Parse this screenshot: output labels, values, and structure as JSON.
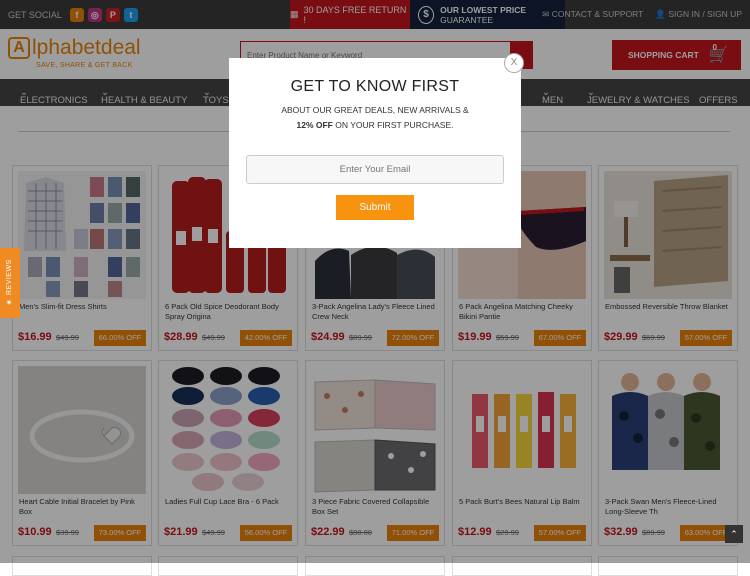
{
  "topbar": {
    "social_label": "GET SOCIAL",
    "social_icons": [
      "facebook-icon",
      "instagram-icon",
      "pinterest-icon",
      "twitter-icon"
    ],
    "promo_return": "30 DAYS FREE RETURN !",
    "promo_price_bold": "OUR LOWEST PRICE",
    "promo_price_rest": "GUARANTEE",
    "contact": "CONTACT & SUPPORT",
    "signin": "SIGN IN / SIGN UP"
  },
  "header": {
    "logo_main": "lphabetdeal",
    "logo_initial": "A",
    "logo_tagline": "SAVE, SHARE & GET BACK",
    "search_placeholder": "Enter Product Name or Keyword",
    "cart_label": "SHOPPING CART",
    "cart_count": "0"
  },
  "nav": {
    "items": [
      "ELECTRONICS",
      "HEALTH & BEAUTY",
      "TOYS",
      "MEN",
      "JEWELRY & WATCHES",
      "OFFERS"
    ]
  },
  "modal": {
    "heading": "GET TO KNOW FIRST",
    "line1": "ABOUT OUR GREAT DEALS, NEW ARRIVALS &",
    "line2_bold": "12% OFF",
    "line2_rest": "ON YOUR FIRST PURCHASE.",
    "email_placeholder": "Enter Your Email",
    "submit_label": "Submit",
    "close_label": "X"
  },
  "reviews_tab": "★ REVIEWS",
  "products": [
    {
      "title": "Men's Slim-fit Dress Shirts",
      "price": "$16.99",
      "old": "$49.99",
      "off": "66.00% OFF"
    },
    {
      "title": "6 Pack Old Spice Deodorant Body Spray Origina",
      "price": "$28.99",
      "old": "$49.99",
      "off": "42.00% OFF"
    },
    {
      "title": "3-Pack Angelina Lady's Fleece Lined Crew Neck",
      "price": "$24.99",
      "old": "$89.99",
      "off": "72.00% OFF"
    },
    {
      "title": "6 Pack Angelina Matching Cheeky Bikini Pantie",
      "price": "$19.99",
      "old": "$59.99",
      "off": "67.00% OFF"
    },
    {
      "title": "Embossed Reversible Throw Blanket",
      "price": "$29.99",
      "old": "$69.99",
      "off": "57.00% OFF"
    },
    {
      "title": "Heart Cable Initial Bracelet by Pink Box",
      "price": "$10.99",
      "old": "$39.99",
      "off": "73.00% OFF"
    },
    {
      "title": "Ladies Full Cup Lace Bra - 6 Pack",
      "price": "$21.99",
      "old": "$49.99",
      "off": "56.00% OFF"
    },
    {
      "title": "3 Piece Fabric Covered Collapsible Box Set",
      "price": "$22.99",
      "old": "$80.00",
      "off": "71.00% OFF"
    },
    {
      "title": "5 Pack Burt's Bees Natural Lip Balm",
      "price": "$12.99",
      "old": "$29.99",
      "off": "57.00% OFF"
    },
    {
      "title": "3-Pack Swan Men's Fleece-Lined Long-Sleeve Th",
      "price": "$32.99",
      "old": "$89.99",
      "off": "63.00% OFF"
    }
  ]
}
